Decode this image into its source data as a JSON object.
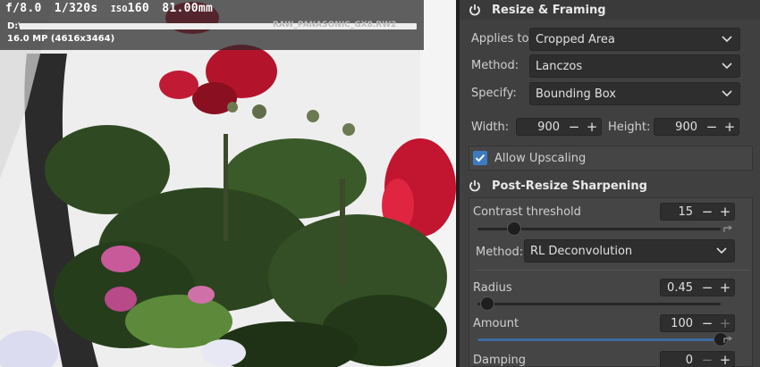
{
  "photo": {
    "exif": {
      "aperture": "f/8.0",
      "shutter": "1/320s",
      "iso_label": "ISO",
      "iso": "160",
      "focal": "81.00mm"
    },
    "filename_prefix": "D:\\",
    "filename_tail": "RAW_PANASONIC_GX8.RW2",
    "megapixels": "16.0 MP (4616x3464)"
  },
  "resize": {
    "title": "Resize & Framing",
    "applies_label": "Applies to:",
    "applies_value": "Cropped Area",
    "method_label": "Method:",
    "method_value": "Lanczos",
    "specify_label": "Specify:",
    "specify_value": "Bounding Box",
    "width_label": "Width:",
    "width_value": "900",
    "height_label": "Height:",
    "height_value": "900",
    "upscale_label": "Allow Upscaling",
    "upscale_checked": true
  },
  "sharpen": {
    "title": "Post-Resize Sharpening",
    "contrast_label": "Contrast threshold",
    "contrast_value": "15",
    "contrast_level": 0.15,
    "method_label": "Method:",
    "method_value": "RL Deconvolution",
    "radius_label": "Radius",
    "radius_value": "0.45",
    "radius_level": 0.04,
    "amount_label": "Amount",
    "amount_value": "100",
    "amount_level": 1.0,
    "damping_label": "Damping",
    "damping_value": "0"
  },
  "glyphs": {
    "minus": "−",
    "plus": "+"
  },
  "colors": {
    "accent": "#3d7bc0",
    "panel": "#404040"
  }
}
